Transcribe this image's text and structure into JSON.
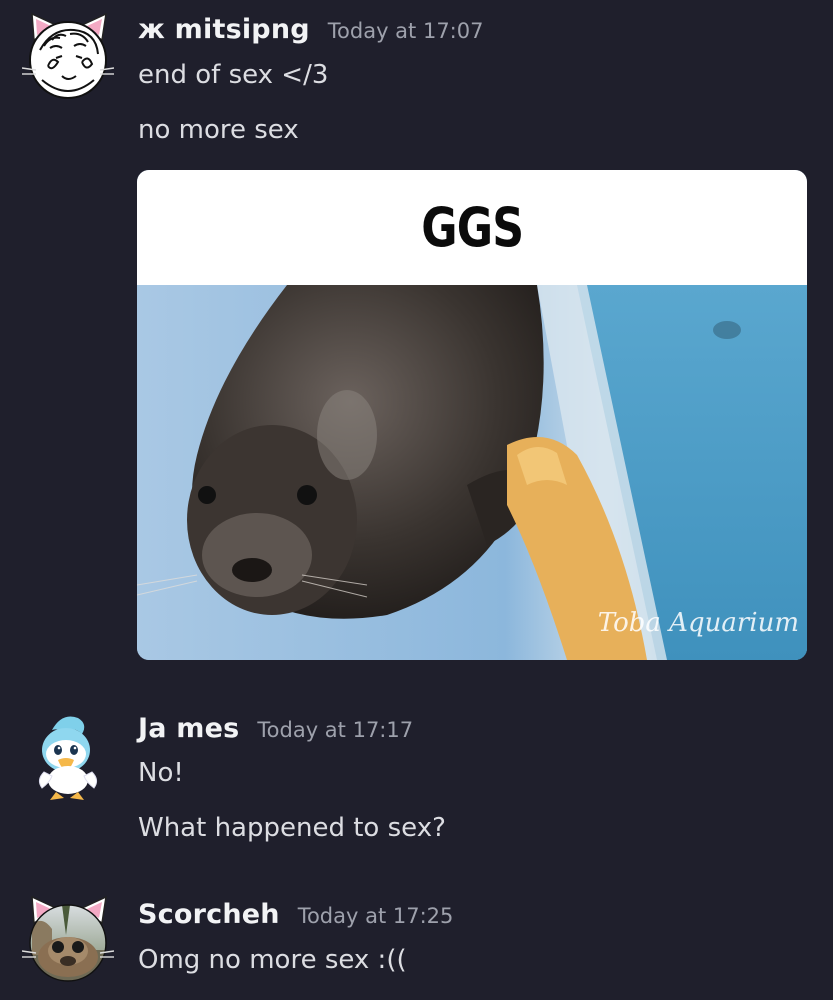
{
  "messages": [
    {
      "username": "ж mitsipng",
      "timestamp": "Today at 17:07",
      "lines": [
        "end of sex </3",
        "no more sex"
      ],
      "attachment": {
        "caption": "GGS",
        "watermark": "Toba Aquarium"
      }
    },
    {
      "username": "Ja mes",
      "timestamp": "Today at 17:17",
      "lines": [
        "No!",
        "What happened to sex?"
      ]
    },
    {
      "username": "Scorcheh",
      "timestamp": "Today at 17:25",
      "lines": [
        "Omg no more sex :(("
      ]
    }
  ],
  "colors": {
    "background": "#1f1f2c",
    "username": "#f2f3f5",
    "timestamp": "#9ea1ac",
    "message_text": "#dcdde2"
  },
  "icons": {
    "avatar_1": "cat-ear-sketch-avatar-icon",
    "avatar_2": "duck-avatar-icon",
    "avatar_3": "cat-ear-photo-avatar-icon"
  }
}
